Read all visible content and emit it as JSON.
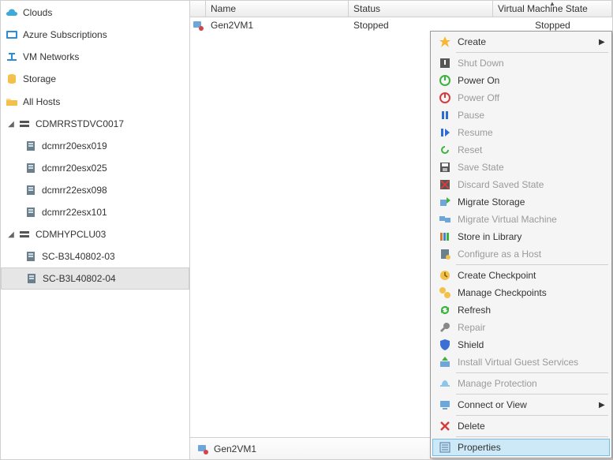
{
  "sidebar": {
    "nav": [
      {
        "id": "clouds",
        "label": "Clouds"
      },
      {
        "id": "azure",
        "label": "Azure Subscriptions"
      },
      {
        "id": "vmnet",
        "label": "VM Networks"
      },
      {
        "id": "storage",
        "label": "Storage"
      }
    ],
    "hosts_root_label": "All Hosts",
    "clusters": [
      {
        "label": "CDMRRSTDVC0017",
        "nodes": [
          {
            "label": "dcmrr20esx019"
          },
          {
            "label": "dcmrr20esx025"
          },
          {
            "label": "dcmrr22esx098"
          },
          {
            "label": "dcmrr22esx101"
          }
        ]
      },
      {
        "label": "CDMHYPCLU03",
        "nodes": [
          {
            "label": "SC-B3L40802-03"
          },
          {
            "label": "SC-B3L40802-04"
          }
        ]
      }
    ],
    "selected_node": "SC-B3L40802-04"
  },
  "list": {
    "columns": {
      "name": "Name",
      "status": "Status",
      "vmstate": "Virtual Machine State"
    },
    "rows": [
      {
        "name": "Gen2VM1",
        "status": "Stopped",
        "vmstate": "Stopped"
      }
    ]
  },
  "statusbar": {
    "selected_vm": "Gen2VM1"
  },
  "contextmenu": {
    "items": [
      {
        "label": "Create",
        "icon": "create",
        "submenu": true
      },
      {
        "sep": true
      },
      {
        "label": "Shut Down",
        "icon": "shutdown",
        "disabled": true
      },
      {
        "label": "Power On",
        "icon": "poweron"
      },
      {
        "label": "Power Off",
        "icon": "poweroff",
        "disabled": true
      },
      {
        "label": "Pause",
        "icon": "pause",
        "disabled": true
      },
      {
        "label": "Resume",
        "icon": "resume",
        "disabled": true
      },
      {
        "label": "Reset",
        "icon": "reset",
        "disabled": true
      },
      {
        "label": "Save State",
        "icon": "save",
        "disabled": true
      },
      {
        "label": "Discard Saved State",
        "icon": "discard",
        "disabled": true
      },
      {
        "label": "Migrate Storage",
        "icon": "migratestorage"
      },
      {
        "label": "Migrate Virtual Machine",
        "icon": "migratevm",
        "disabled": true
      },
      {
        "label": "Store in Library",
        "icon": "library"
      },
      {
        "label": "Configure as a Host",
        "icon": "cfgashost",
        "disabled": true
      },
      {
        "sep": true
      },
      {
        "label": "Create Checkpoint",
        "icon": "checkpoint"
      },
      {
        "label": "Manage Checkpoints",
        "icon": "managecheckpoints"
      },
      {
        "label": "Refresh",
        "icon": "refresh"
      },
      {
        "label": "Repair",
        "icon": "repair",
        "disabled": true
      },
      {
        "label": "Shield",
        "icon": "shield"
      },
      {
        "label": "Install Virtual Guest Services",
        "icon": "installguest",
        "disabled": true
      },
      {
        "sep": true
      },
      {
        "label": "Manage Protection",
        "icon": "protection",
        "disabled": true
      },
      {
        "sep": true
      },
      {
        "label": "Connect or View",
        "icon": "connect",
        "submenu": true
      },
      {
        "sep": true
      },
      {
        "label": "Delete",
        "icon": "delete"
      },
      {
        "sep": true
      },
      {
        "label": "Properties",
        "icon": "properties",
        "highlight": true
      }
    ]
  }
}
